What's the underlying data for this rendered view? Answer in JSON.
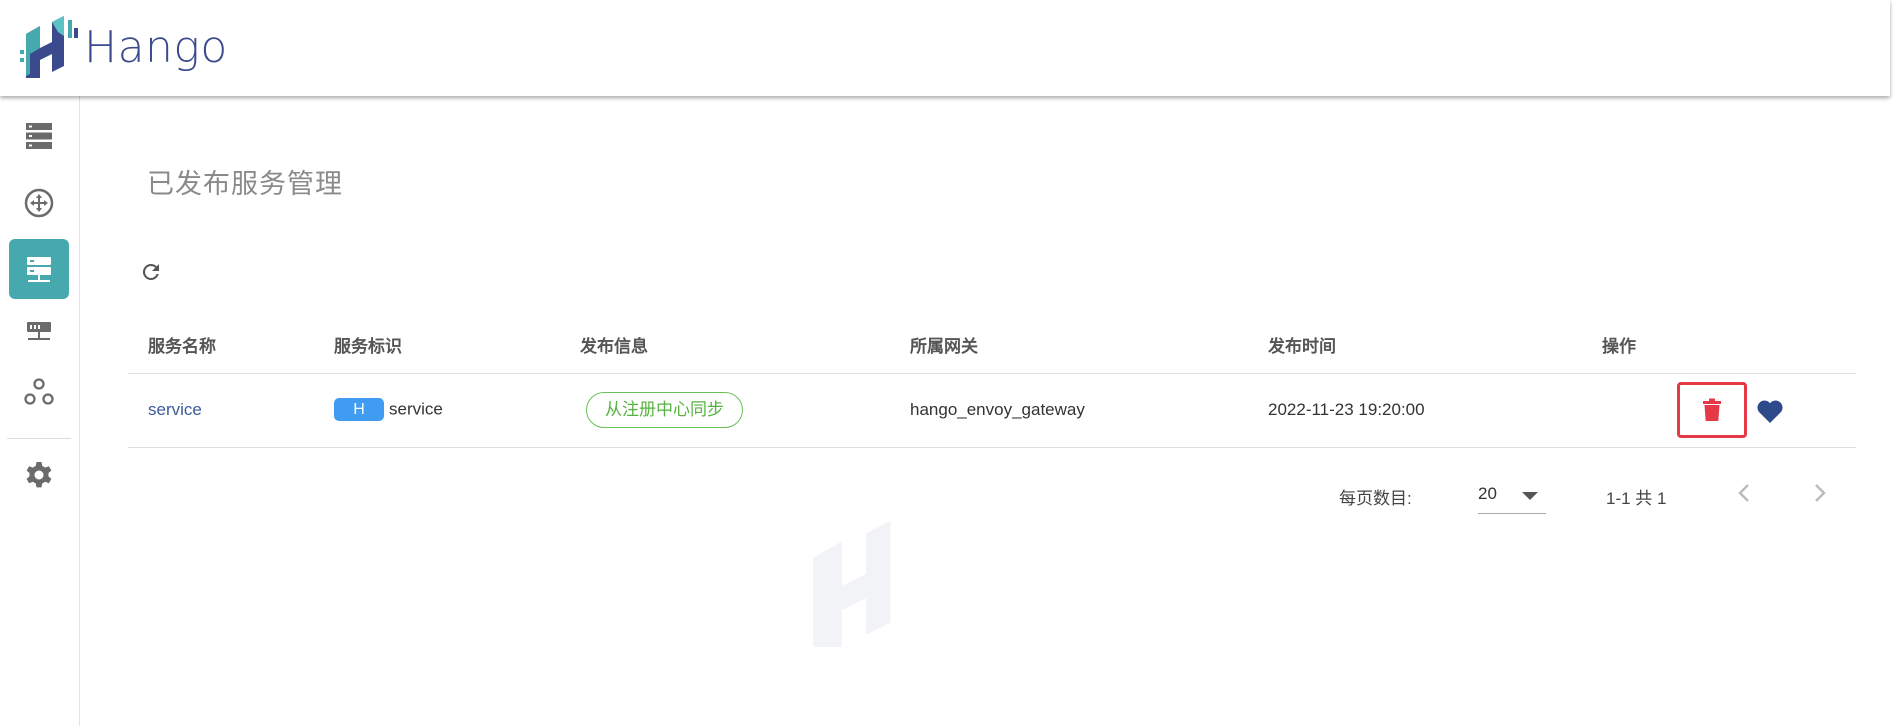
{
  "app": {
    "brand": "Hango",
    "brand_color": "#3b4a8c",
    "accent_color": "#46a9ad"
  },
  "sidebar": {
    "items": [
      {
        "icon": "server-list-icon",
        "active": false
      },
      {
        "icon": "route-hub-icon",
        "active": false
      },
      {
        "icon": "published-service-icon",
        "active": true
      },
      {
        "icon": "gateway-device-icon",
        "active": false
      },
      {
        "icon": "plugin-cluster-icon",
        "active": false
      },
      {
        "icon": "gear-icon",
        "active": false
      }
    ]
  },
  "page": {
    "title": "已发布服务管理"
  },
  "table": {
    "headers": {
      "name": "服务名称",
      "identifier": "服务标识",
      "publish_info": "发布信息",
      "gateway": "所属网关",
      "publish_time": "发布时间",
      "actions": "操作"
    },
    "rows": [
      {
        "name": "service",
        "badge": "H",
        "identifier": "service",
        "publish_info": "从注册中心同步",
        "gateway": "hango_envoy_gateway",
        "publish_time": "2022-11-23 19:20:00"
      }
    ]
  },
  "pagination": {
    "per_page_label": "每页数目:",
    "per_page_value": "20",
    "range_text": "1-1 共 1"
  },
  "colors": {
    "danger": "#e53947",
    "tag_green": "#56b340",
    "badge_blue": "#3f9cf0",
    "favorite": "#2f4a8a"
  }
}
